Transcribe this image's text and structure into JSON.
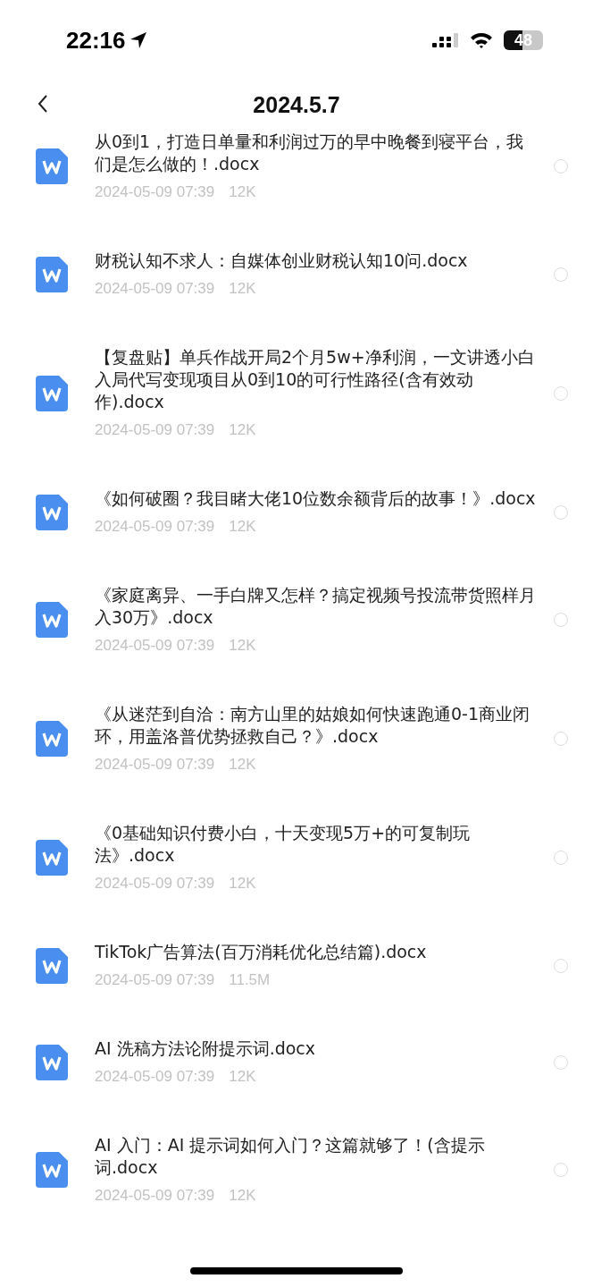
{
  "status_bar": {
    "time": "22:16",
    "battery": "48"
  },
  "header": {
    "title": "2024.5.7"
  },
  "files": [
    {
      "name": "从0到1，打造日单量和利润过万的早中晚餐到寝平台，我们是怎么做的！.docx",
      "date": "2024-05-09 07:39",
      "size": "12K",
      "selected": false
    },
    {
      "name": "财税认知不求人：自媒体创业财税认知10问.docx",
      "date": "2024-05-09 07:39",
      "size": "12K",
      "selected": false
    },
    {
      "name": "【复盘贴】单兵作战开局2个月5w+净利润，一文讲透小白入局代写变现项目从0到10的可行性路径(含有效动作).docx",
      "date": "2024-05-09 07:39",
      "size": "12K",
      "selected": false
    },
    {
      "name": "《如何破圈？我目睹大佬10位数余额背后的故事！》.docx",
      "date": "2024-05-09 07:39",
      "size": "12K",
      "selected": false
    },
    {
      "name": "《家庭离异、一手白牌又怎样？搞定视频号投流带货照样月入30万》.docx",
      "date": "2024-05-09 07:39",
      "size": "12K",
      "selected": false
    },
    {
      "name": "《从迷茫到自洽：南方山里的姑娘如何快速跑通0-1商业闭环，用盖洛普优势拯救自己？》.docx",
      "date": "2024-05-09 07:39",
      "size": "12K",
      "selected": false
    },
    {
      "name": "《0基础知识付费小白，十天变现5万+的可复制玩法》.docx",
      "date": "2024-05-09 07:39",
      "size": "12K",
      "selected": false
    },
    {
      "name": "TikTok广告算法(百万消耗优化总结篇).docx",
      "date": "2024-05-09 07:39",
      "size": "11.5M",
      "selected": false
    },
    {
      "name": "AI 洗稿方法论附提示词.docx",
      "date": "2024-05-09 07:39",
      "size": "12K",
      "selected": false
    },
    {
      "name": "AI 入门：AI 提示词如何入门？这篇就够了！(含提示词.docx",
      "date": "2024-05-09 07:39",
      "size": "12K",
      "selected": false
    }
  ]
}
